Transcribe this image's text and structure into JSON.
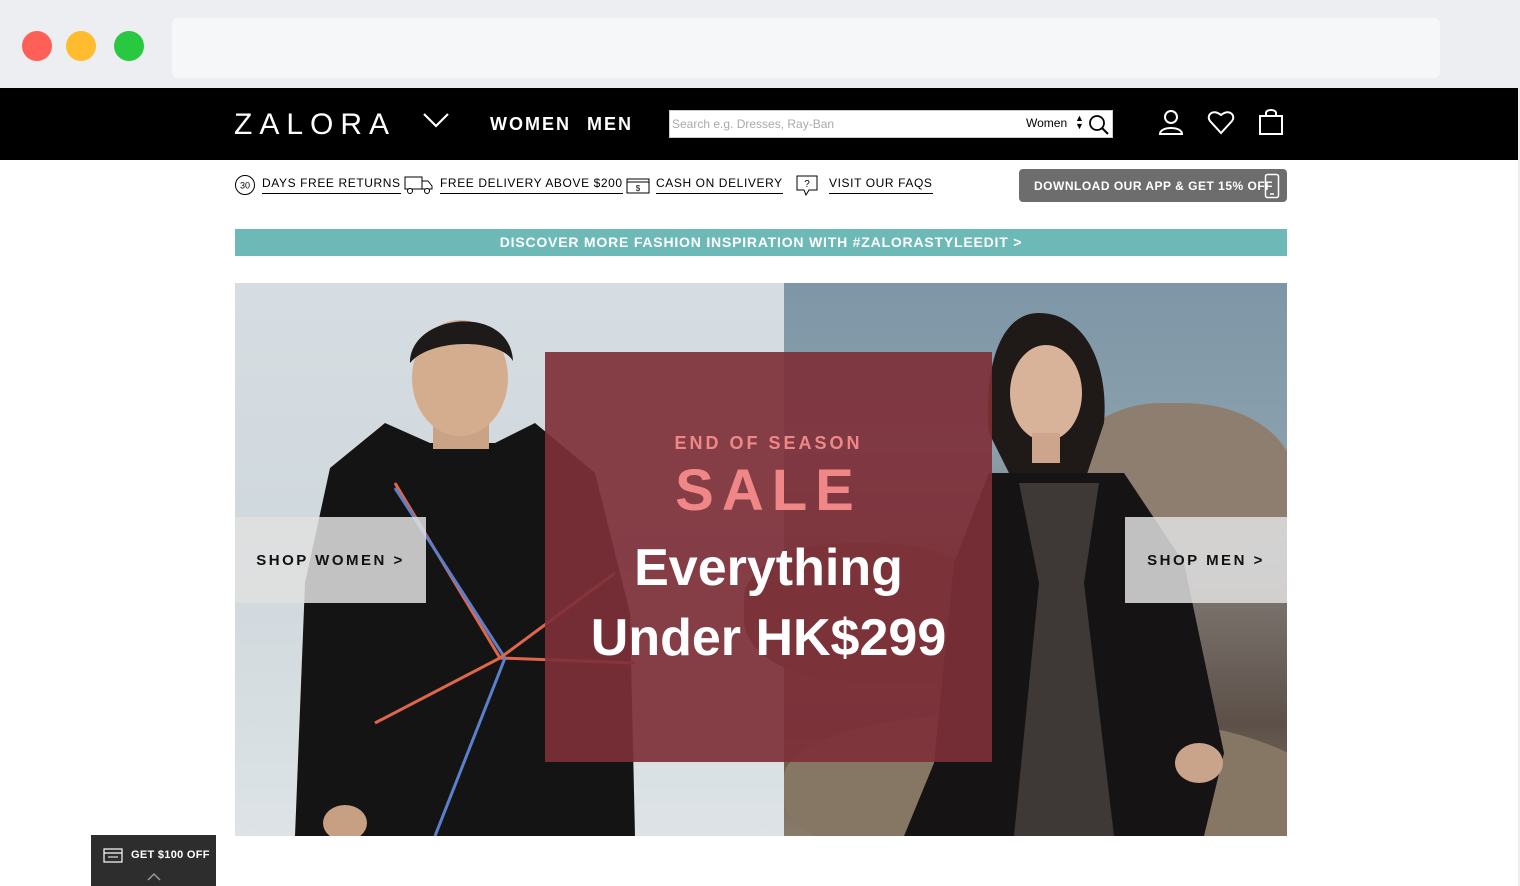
{
  "brand": {
    "logo": "ZALORA"
  },
  "nav": {
    "women": "WOMEN",
    "men": "MEN"
  },
  "search": {
    "placeholder": "Search e.g. Dresses, Ray-Ban",
    "category": "Women"
  },
  "icons": {
    "logo_dropdown": "chevron-down-icon",
    "search": "search-icon",
    "account": "user-icon",
    "wishlist": "heart-icon",
    "bag": "shopping-bag-icon",
    "returns": "thirty-days-icon",
    "delivery": "truck-icon",
    "cash": "cash-icon",
    "faq": "faq-bubble-icon",
    "phone": "phone-icon",
    "coupon": "coupon-icon",
    "chevron_up": "chevron-up-icon"
  },
  "usp": {
    "returns_badge": "30",
    "returns": "DAYS FREE RETURNS",
    "delivery": "FREE DELIVERY ABOVE $200",
    "cash": "CASH ON DELIVERY",
    "faq": "VISIT OUR FAQS",
    "app": "DOWNLOAD OUR APP & GET 15% OFF"
  },
  "banner": {
    "discover": "DISCOVER MORE FASHION INSPIRATION WITH #ZALORASTYLEEDIT >"
  },
  "hero": {
    "eyebrow": "END OF SEASON",
    "headline": "SALE",
    "line1": "Everything",
    "line2": "Under HK$299",
    "shop_women": "SHOP WOMEN >",
    "shop_men": "SHOP MEN >"
  },
  "coupon": {
    "label": "GET $100 OFF"
  },
  "colors": {
    "nav_bg": "#000000",
    "discover_bg": "#6cb9b7",
    "sale_box": "#7e3038",
    "sale_accent": "#f08787",
    "app_button": "#6d6d6d"
  }
}
